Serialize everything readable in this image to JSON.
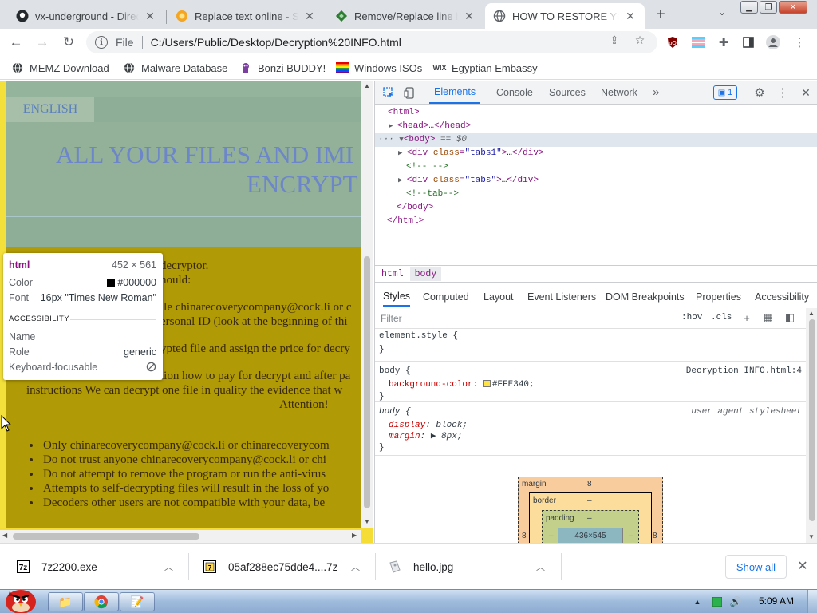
{
  "tabs": [
    {
      "title": "vx-underground - Direc",
      "icon": "github-icon"
    },
    {
      "title": "Replace text online - Sp",
      "icon": "sun-icon"
    },
    {
      "title": "Remove/Replace line b",
      "icon": "diamond-icon"
    },
    {
      "title": "HOW TO RESTORE YOU",
      "icon": "globe-icon",
      "active": true
    }
  ],
  "toolbar": {
    "scheme": "File",
    "url": "C:/Users/Public/Desktop/Decryption%20INFO.html"
  },
  "bookmarks": [
    {
      "label": "MEMZ Download",
      "icon": "globe-icon"
    },
    {
      "label": "Malware Database",
      "icon": "globe-icon"
    },
    {
      "label": "Bonzi BUDDY!",
      "icon": "bonzi-icon"
    },
    {
      "label": "Windows ISOs",
      "icon": "windows-icon"
    },
    {
      "label": "Egyptian Embassy",
      "icon": "wix-icon",
      "icon_text": "WIX"
    }
  ],
  "page": {
    "lang_tab": "ENGLISH",
    "headline_l1": "ALL YOUR FILES AND IMI",
    "headline_l2": "ENCRYPT",
    "lines": [
      "decryptor.",
      "hould:",
      "ile chinarecoverycompany@cock.li or c",
      "ersonal ID (look at the beginning of thi",
      "ypted file and assign the price for decry",
      "tion how to pay for decrypt and after pa",
      "instructions We can decrypt one file in quality the evidence that w",
      "Attention!"
    ],
    "bullets": [
      "Only chinarecoverycompany@cock.li or chinarecoverycom",
      "Do not trust anyone chinarecoverycompany@cock.li or chi",
      "Do not attempt to remove the program or run the anti-virus",
      "Attempts to self-decrypting files will result in the loss of yo",
      "Decoders other users are not compatible with your data, be"
    ],
    "colors": {
      "body_bg": "#b09a05",
      "header_bg": "#8fae98",
      "headline": "#6c86c9"
    }
  },
  "tooltip": {
    "tag": "html",
    "size": "452 × 561",
    "color_label": "Color",
    "color_value": "#000000",
    "font_label": "Font",
    "font_value": "16px \"Times New Roman\"",
    "section": "ACCESSIBILITY",
    "name_label": "Name",
    "role_label": "Role",
    "role_value": "generic",
    "kf_label": "Keyboard-focusable"
  },
  "devtools": {
    "tabs": [
      "Elements",
      "Console",
      "Sources",
      "Network"
    ],
    "more": "»",
    "badge": "1",
    "dom": {
      "html_open": "<html>",
      "head": "<head>…</head>",
      "body_open": "<body>",
      "body_hint": "== $0",
      "div1_tag": "div",
      "div1_attr": "class",
      "div1_val": "\"tabs1\"",
      "comment1": "<!-- -->",
      "div2_val": "\"tabs\"",
      "comment2": "<!--tab-->",
      "body_close": "</body>",
      "html_close": "</html>",
      "ellipsis": "…"
    },
    "crumbs": [
      "html",
      "body"
    ],
    "panel_tabs": [
      "Styles",
      "Computed",
      "Layout",
      "Event Listeners",
      "DOM Breakpoints",
      "Properties",
      "Accessibility"
    ],
    "filter_placeholder": "Filter",
    "hov": ":hov",
    "cls": ".cls",
    "rules": {
      "element_style": "element.style {",
      "close": "}",
      "body_sel": "body {",
      "bg_prop": "background-color",
      "bg_val": "#FFE340;",
      "bg_color": "#FFE340",
      "source": "Decryption INFO.html:4",
      "ua_label": "user agent stylesheet",
      "display_prop": "display",
      "display_val": "block;",
      "margin_prop": "margin",
      "margin_val": "8px;"
    },
    "boxmodel": {
      "margin_label": "margin",
      "margin_top": "8",
      "border_label": "border",
      "border_val": "–",
      "padding_label": "padding",
      "padding_val": "–",
      "content": "436×545",
      "side": "8",
      "dash": "–"
    }
  },
  "downloads": [
    {
      "name": "7z2200.exe",
      "icon": "7zip-icon"
    },
    {
      "name": "05af288ec75dde4....7z",
      "icon": "7zip-icon"
    },
    {
      "name": "hello.jpg",
      "icon": "image-icon"
    }
  ],
  "shelf": {
    "show_all": "Show all"
  },
  "taskbar": {
    "time": "5:09 AM"
  }
}
